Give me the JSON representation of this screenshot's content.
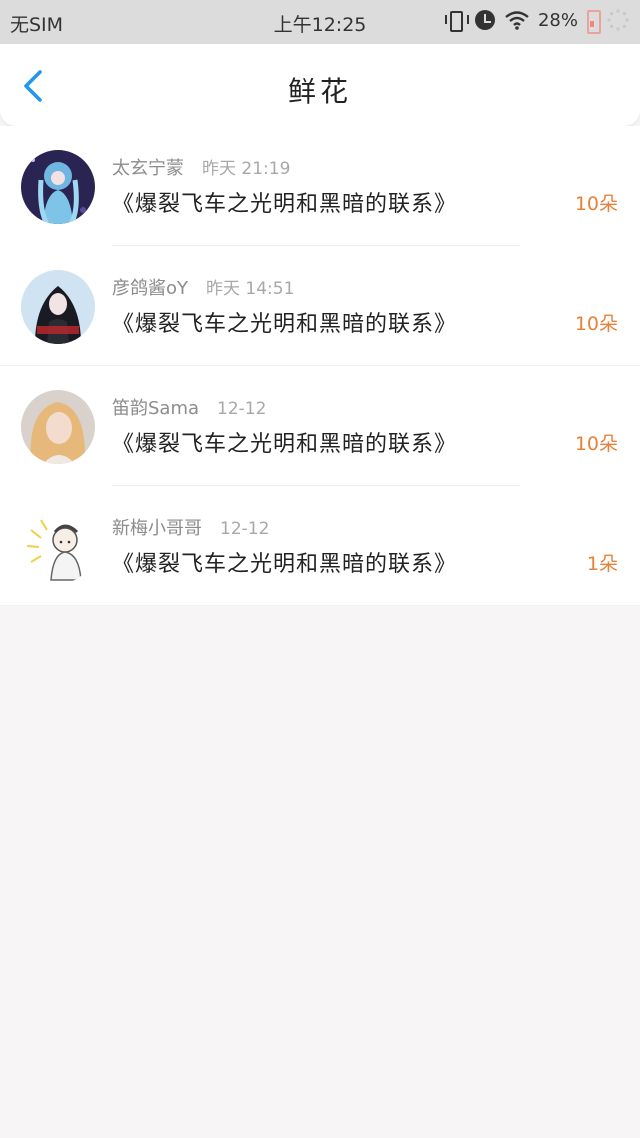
{
  "status_bar": {
    "carrier": "无SIM",
    "time": "上午12:25",
    "battery": "28%",
    "icons": [
      "vibrate-icon",
      "alarm-icon",
      "wifi-icon",
      "battery-icon",
      "loading-icon"
    ]
  },
  "header": {
    "title": "鲜花",
    "back_icon": "chevron-left-icon"
  },
  "colors": {
    "accent_blue": "#2196f3",
    "count_orange": "#e8823a",
    "meta_gray": "#8c8c8c"
  },
  "items": [
    {
      "user": "太玄宁蒙",
      "time": "昨天 21:19",
      "title": "《爆裂飞车之光明和黑暗的联系》",
      "count": "10朵"
    },
    {
      "user": "彦鸽酱οY",
      "time": "昨天 14:51",
      "title": "《爆裂飞车之光明和黑暗的联系》",
      "count": "10朵"
    },
    {
      "user": "笛韵Sama",
      "time": "12-12",
      "title": "《爆裂飞车之光明和黑暗的联系》",
      "count": "10朵"
    },
    {
      "user": "新梅小哥哥",
      "time": "12-12",
      "title": "《爆裂飞车之光明和黑暗的联系》",
      "count": "1朵"
    }
  ]
}
